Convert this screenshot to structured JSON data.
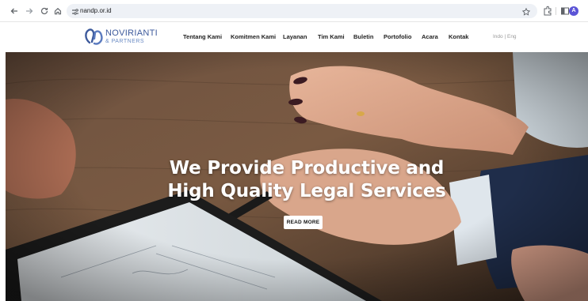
{
  "browser": {
    "url": "nandp.or.id",
    "profile_initial": "A"
  },
  "site": {
    "logo": {
      "name": "NOVIRIANTI",
      "sub": "& PARTNERS"
    },
    "menu": [
      {
        "label": "Tentang Kami"
      },
      {
        "label": "Komitmen Kami"
      },
      {
        "label": "Layanan"
      },
      {
        "label": "Tim Kami"
      },
      {
        "label": "Buletin"
      },
      {
        "label": "Portofolio"
      },
      {
        "label": "Acara"
      },
      {
        "label": "Kontak"
      }
    ],
    "lang": {
      "indo": "Indo",
      "separator": "|",
      "eng": "Eng"
    }
  },
  "hero": {
    "title_line1": "We Provide Productive and",
    "title_line2": "High Quality Legal Services",
    "cta": "READ MORE"
  },
  "colors": {
    "brand_blue": "#3d5a9c",
    "menu_text": "#222222",
    "hero_text": "#ffffff"
  }
}
